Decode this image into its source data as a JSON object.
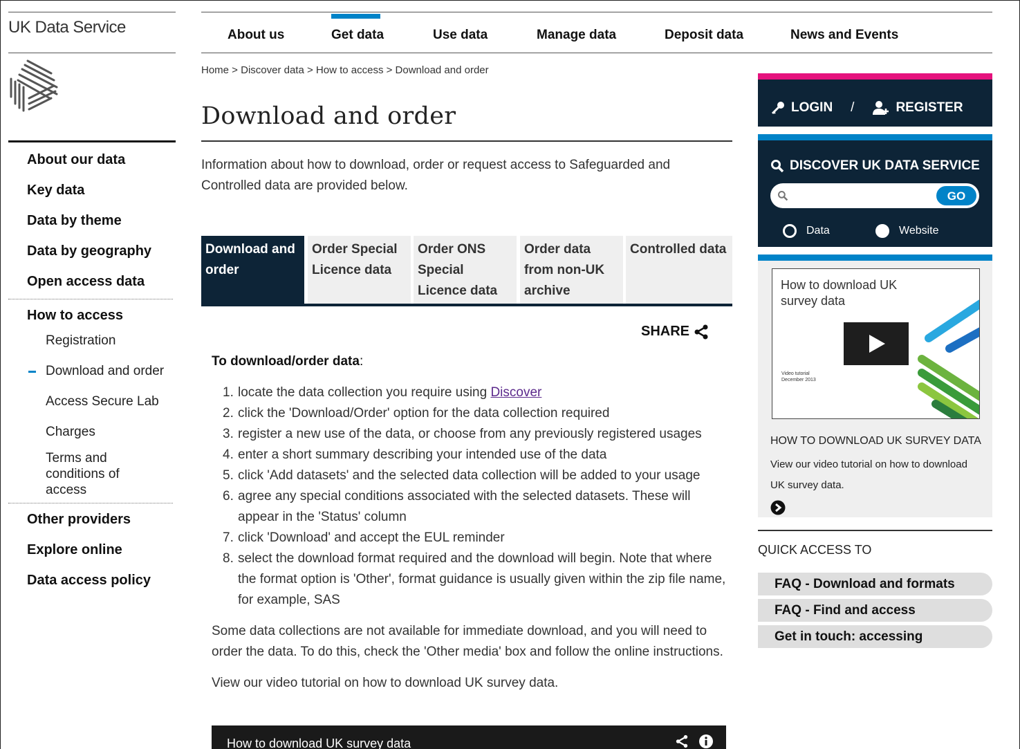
{
  "brand": "UK Data Service",
  "topnav": [
    "About us",
    "Get data",
    "Use data",
    "Manage data",
    "Deposit data",
    "News and Events"
  ],
  "breadcrumb": "Home > Discover data > How to access > Download and order",
  "page_title": "Download and order",
  "intro": "Information about how to download, order or request access to Safeguarded and Controlled data are provided below.",
  "leftnav": {
    "main": [
      "About our data",
      "Key data",
      "Data by theme",
      "Data by geography",
      "Open access data"
    ],
    "section": "How to access",
    "sub": [
      "Registration",
      "Download and order",
      "Access Secure Lab",
      "Charges",
      "Terms and conditions of access"
    ],
    "bottom": [
      "Other providers",
      "Explore online",
      "Data access policy"
    ]
  },
  "tabs": [
    "Download and order",
    "Order Special Licence data",
    "Order ONS Special Licence data",
    "Order data from non-UK archive",
    "Controlled data"
  ],
  "share": "SHARE",
  "content": {
    "heading": "To download/order data",
    "heading_colon": ":",
    "steps": [
      {
        "num": "1.",
        "text": "locate the data collection you require using ",
        "link": "Discover"
      },
      {
        "num": "2.",
        "text": "click the 'Download/Order' option for the data collection required"
      },
      {
        "num": "3.",
        "text": "register a new use of the data, or choose from any previously registered usages"
      },
      {
        "num": "4.",
        "text": "enter a short summary describing your intended use of the data"
      },
      {
        "num": "5.",
        "text": "click 'Add datasets' and the selected data collection will be added to your usage"
      },
      {
        "num": "6.",
        "text": "agree any special conditions associated with the selected datasets. These will appear in the 'Status' column"
      },
      {
        "num": "7.",
        "text": "click 'Download' and accept the EUL reminder"
      },
      {
        "num": "8.",
        "text": "select the download format required and the download will begin. Note that where the format option is 'Other', format guidance is usually given within the zip file name, for example, SAS"
      }
    ],
    "para1": "Some data collections are not available for immediate download, and you will need to order the data. To do this, check the 'Other media' box and follow the online instructions.",
    "para2": "View our video tutorial on how to download UK survey data.",
    "video_title": "How to download UK survey data"
  },
  "right": {
    "login": "LOGIN",
    "separator": "/",
    "register": "REGISTER",
    "discover_title": "DISCOVER UK DATA SERVICE",
    "search_placeholder": "",
    "go": "GO",
    "radio_data": "Data",
    "radio_website": "Website",
    "thumb_title": "How to download UK survey data",
    "thumb_small_1": "Video tutorial",
    "thumb_small_2": "December 2013",
    "card_title": "HOW TO DOWNLOAD UK SURVEY DATA",
    "card_text": "View our video tutorial on how to download UK survey data.",
    "quick_access": "QUICK ACCESS TO",
    "quick_links": [
      "FAQ - Download and formats",
      "FAQ - Find and access",
      "Get in touch: accessing"
    ]
  },
  "colors": {
    "navy": "#0d2437",
    "blue": "#0083c8",
    "pink": "#e5127d",
    "link": "#5c2a8c"
  },
  "icons": [
    "uk-data-service-logo-icon",
    "key-icon",
    "add-user-icon",
    "search-icon",
    "share-icon",
    "arrow-right-circle-icon",
    "play-icon",
    "info-icon"
  ]
}
